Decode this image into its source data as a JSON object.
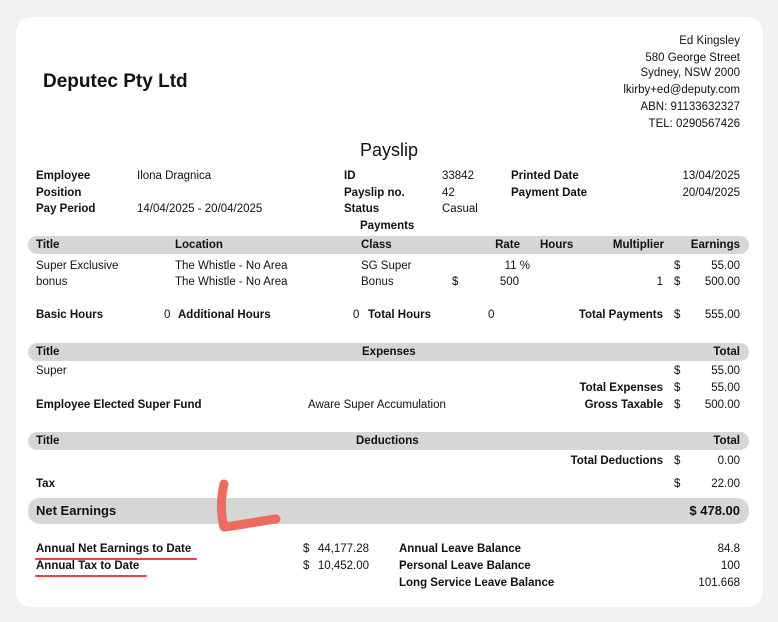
{
  "company": {
    "name": "Deputec Pty Ltd"
  },
  "address": {
    "name": "Ed Kingsley",
    "street": "580 George Street",
    "city": "Sydney, NSW 2000",
    "email": "lkirby+ed@deputy.com",
    "abn": "ABN: 91133632327",
    "tel": "TEL: 0290567426"
  },
  "title": "Payslip",
  "info": {
    "employee_label": "Employee",
    "employee": "Ilona Dragnica",
    "position_label": "Position",
    "period_label": "Pay Period",
    "period": "14/04/2025 - 20/04/2025",
    "id_label": "ID",
    "id": "33842",
    "payslip_label": "Payslip no.",
    "payslip": "42",
    "status_label": "Status",
    "status": "Casual",
    "printed_label": "Printed Date",
    "printed": "13/04/2025",
    "paydate_label": "Payment Date",
    "paydate": "20/04/2025"
  },
  "payments": {
    "heading": "Payments",
    "headers": {
      "title": "Title",
      "location": "Location",
      "class": "Class",
      "rate": "Rate",
      "hours": "Hours",
      "multiplier": "Multiplier",
      "earnings": "Earnings"
    },
    "rows": [
      {
        "title": "Super Exclusive",
        "location": "The Whistle - No Area",
        "class": "SG Super",
        "rate_cur": "",
        "rate": "11 %",
        "multiplier": "",
        "earn_cur": "$",
        "earnings": "55.00"
      },
      {
        "title": "bonus",
        "location": "The Whistle - No Area",
        "class": "Bonus",
        "rate_cur": "$",
        "rate": "500",
        "multiplier": "1",
        "earn_cur": "$",
        "earnings": "500.00"
      }
    ],
    "basic_label": "Basic Hours",
    "basic": "0",
    "additional_label": "Additional Hours",
    "additional": "0",
    "total_hours_label": "Total Hours",
    "total_hours": "0",
    "total_label": "Total Payments",
    "total_cur": "$",
    "total": "555.00"
  },
  "expenses": {
    "title_header": "Title",
    "heading": "Expenses",
    "total_header": "Total",
    "row_title": "Super",
    "row_cur": "$",
    "row_value": "55.00",
    "total_label": "Total Expenses",
    "total_cur": "$",
    "total": "55.00",
    "fund_label": "Employee Elected Super Fund",
    "fund": "Aware Super Accumulation",
    "gross_label": "Gross Taxable",
    "gross_cur": "$",
    "gross": "500.00"
  },
  "deductions": {
    "title_header": "Title",
    "heading": "Deductions",
    "total_header": "Total",
    "total_label": "Total Deductions",
    "total_cur": "$",
    "total": "0.00",
    "tax_label": "Tax",
    "tax_cur": "$",
    "tax": "22.00"
  },
  "net": {
    "label": "Net Earnings",
    "value": "$ 478.00"
  },
  "annual": {
    "net_label": "Annual Net Earnings to Date",
    "net_cur": "$",
    "net": "44,177.28",
    "tax_label": "Annual Tax to Date",
    "tax_cur": "$",
    "tax": "10,452.00"
  },
  "leave": {
    "annual_label": "Annual Leave Balance",
    "annual": "84.8",
    "personal_label": "Personal Leave Balance",
    "personal": "100",
    "long_label": "Long Service Leave Balance",
    "long": "101.668"
  },
  "colors": {
    "annotation": "#e0453f",
    "bar": "#d6d6d6",
    "background": "#f1f1f1"
  }
}
